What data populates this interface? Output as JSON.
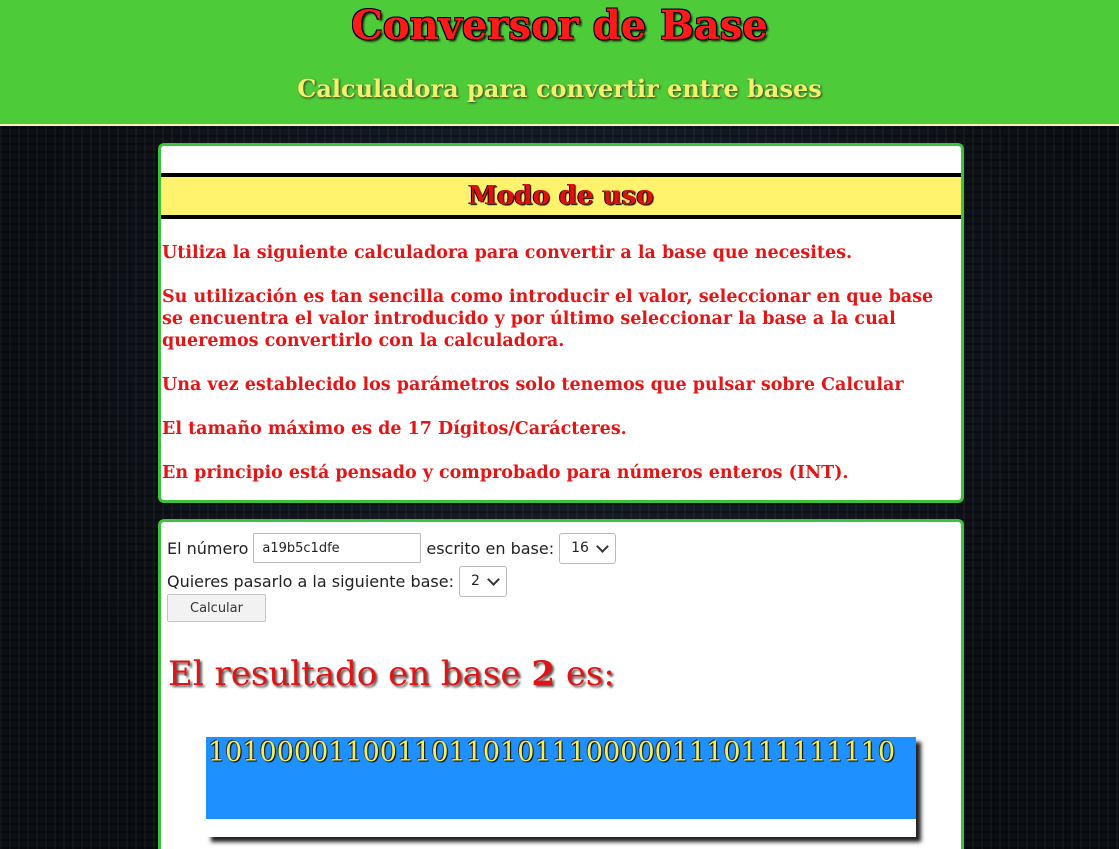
{
  "header": {
    "title": "Conversor de Base",
    "subtitle": "Calculadora para convertir entre bases"
  },
  "usage": {
    "heading": "Modo de uso",
    "paragraphs": [
      "Utiliza la siguiente calculadora para convertir a la base que necesites.",
      "Su utilización es tan sencilla como introducir el valor, seleccionar en que base se encuentra el valor introducido y por último seleccionar la base a la cual queremos convertirlo con la calculadora.",
      "Una vez establecido los parámetros solo tenemos que pulsar sobre Calcular",
      "El tamaño máximo es de 17 Dígitos/Carácteres.",
      "En principio está pensado y comprobado para números enteros (INT)."
    ]
  },
  "calculator": {
    "number_label": "El número",
    "number_value": "a19b5c1dfe",
    "from_base_label": "escrito en base:",
    "from_base_value": "16",
    "to_base_label": "Quieres pasarlo a la siguiente base:",
    "to_base_value": "2",
    "button_label": "Calcular"
  },
  "result": {
    "heading_prefix": "El resultado en base",
    "heading_base": "2",
    "heading_suffix": "es:",
    "value": "1010000110011011010111000001110111111110"
  },
  "colors": {
    "header_bg": "#4ecb38",
    "title": "#ff1a1a",
    "subtitle": "#f5f06a",
    "usage_band": "#fff36e",
    "usage_text": "#e61414",
    "card_border": "#3cc23c",
    "result_bg": "#1e90ff",
    "result_text": "#f5ee5a"
  },
  "icons": {
    "select_arrow": "chevron-down-icon"
  }
}
